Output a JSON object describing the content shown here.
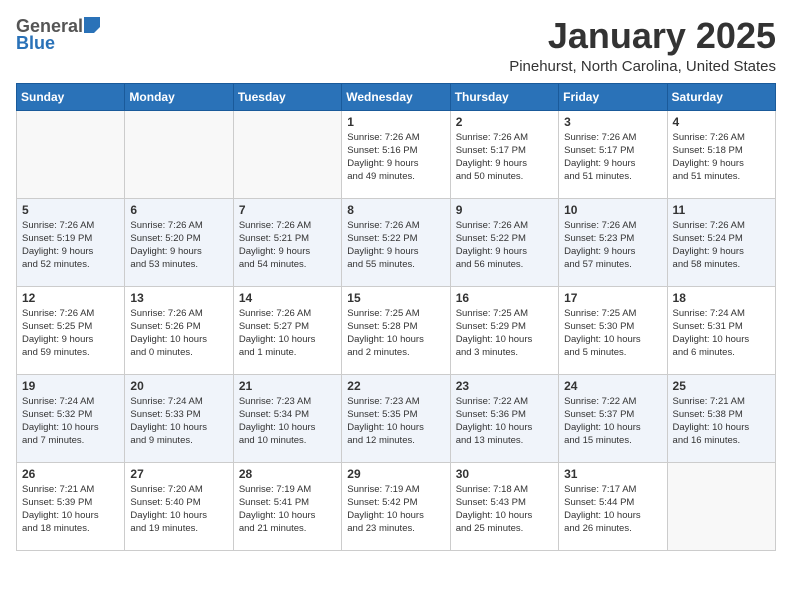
{
  "header": {
    "logo_general": "General",
    "logo_blue": "Blue",
    "month_title": "January 2025",
    "location": "Pinehurst, North Carolina, United States"
  },
  "weekdays": [
    "Sunday",
    "Monday",
    "Tuesday",
    "Wednesday",
    "Thursday",
    "Friday",
    "Saturday"
  ],
  "weeks": [
    [
      {
        "day": "",
        "info": ""
      },
      {
        "day": "",
        "info": ""
      },
      {
        "day": "",
        "info": ""
      },
      {
        "day": "1",
        "info": "Sunrise: 7:26 AM\nSunset: 5:16 PM\nDaylight: 9 hours\nand 49 minutes."
      },
      {
        "day": "2",
        "info": "Sunrise: 7:26 AM\nSunset: 5:17 PM\nDaylight: 9 hours\nand 50 minutes."
      },
      {
        "day": "3",
        "info": "Sunrise: 7:26 AM\nSunset: 5:17 PM\nDaylight: 9 hours\nand 51 minutes."
      },
      {
        "day": "4",
        "info": "Sunrise: 7:26 AM\nSunset: 5:18 PM\nDaylight: 9 hours\nand 51 minutes."
      }
    ],
    [
      {
        "day": "5",
        "info": "Sunrise: 7:26 AM\nSunset: 5:19 PM\nDaylight: 9 hours\nand 52 minutes."
      },
      {
        "day": "6",
        "info": "Sunrise: 7:26 AM\nSunset: 5:20 PM\nDaylight: 9 hours\nand 53 minutes."
      },
      {
        "day": "7",
        "info": "Sunrise: 7:26 AM\nSunset: 5:21 PM\nDaylight: 9 hours\nand 54 minutes."
      },
      {
        "day": "8",
        "info": "Sunrise: 7:26 AM\nSunset: 5:22 PM\nDaylight: 9 hours\nand 55 minutes."
      },
      {
        "day": "9",
        "info": "Sunrise: 7:26 AM\nSunset: 5:22 PM\nDaylight: 9 hours\nand 56 minutes."
      },
      {
        "day": "10",
        "info": "Sunrise: 7:26 AM\nSunset: 5:23 PM\nDaylight: 9 hours\nand 57 minutes."
      },
      {
        "day": "11",
        "info": "Sunrise: 7:26 AM\nSunset: 5:24 PM\nDaylight: 9 hours\nand 58 minutes."
      }
    ],
    [
      {
        "day": "12",
        "info": "Sunrise: 7:26 AM\nSunset: 5:25 PM\nDaylight: 9 hours\nand 59 minutes."
      },
      {
        "day": "13",
        "info": "Sunrise: 7:26 AM\nSunset: 5:26 PM\nDaylight: 10 hours\nand 0 minutes."
      },
      {
        "day": "14",
        "info": "Sunrise: 7:26 AM\nSunset: 5:27 PM\nDaylight: 10 hours\nand 1 minute."
      },
      {
        "day": "15",
        "info": "Sunrise: 7:25 AM\nSunset: 5:28 PM\nDaylight: 10 hours\nand 2 minutes."
      },
      {
        "day": "16",
        "info": "Sunrise: 7:25 AM\nSunset: 5:29 PM\nDaylight: 10 hours\nand 3 minutes."
      },
      {
        "day": "17",
        "info": "Sunrise: 7:25 AM\nSunset: 5:30 PM\nDaylight: 10 hours\nand 5 minutes."
      },
      {
        "day": "18",
        "info": "Sunrise: 7:24 AM\nSunset: 5:31 PM\nDaylight: 10 hours\nand 6 minutes."
      }
    ],
    [
      {
        "day": "19",
        "info": "Sunrise: 7:24 AM\nSunset: 5:32 PM\nDaylight: 10 hours\nand 7 minutes."
      },
      {
        "day": "20",
        "info": "Sunrise: 7:24 AM\nSunset: 5:33 PM\nDaylight: 10 hours\nand 9 minutes."
      },
      {
        "day": "21",
        "info": "Sunrise: 7:23 AM\nSunset: 5:34 PM\nDaylight: 10 hours\nand 10 minutes."
      },
      {
        "day": "22",
        "info": "Sunrise: 7:23 AM\nSunset: 5:35 PM\nDaylight: 10 hours\nand 12 minutes."
      },
      {
        "day": "23",
        "info": "Sunrise: 7:22 AM\nSunset: 5:36 PM\nDaylight: 10 hours\nand 13 minutes."
      },
      {
        "day": "24",
        "info": "Sunrise: 7:22 AM\nSunset: 5:37 PM\nDaylight: 10 hours\nand 15 minutes."
      },
      {
        "day": "25",
        "info": "Sunrise: 7:21 AM\nSunset: 5:38 PM\nDaylight: 10 hours\nand 16 minutes."
      }
    ],
    [
      {
        "day": "26",
        "info": "Sunrise: 7:21 AM\nSunset: 5:39 PM\nDaylight: 10 hours\nand 18 minutes."
      },
      {
        "day": "27",
        "info": "Sunrise: 7:20 AM\nSunset: 5:40 PM\nDaylight: 10 hours\nand 19 minutes."
      },
      {
        "day": "28",
        "info": "Sunrise: 7:19 AM\nSunset: 5:41 PM\nDaylight: 10 hours\nand 21 minutes."
      },
      {
        "day": "29",
        "info": "Sunrise: 7:19 AM\nSunset: 5:42 PM\nDaylight: 10 hours\nand 23 minutes."
      },
      {
        "day": "30",
        "info": "Sunrise: 7:18 AM\nSunset: 5:43 PM\nDaylight: 10 hours\nand 25 minutes."
      },
      {
        "day": "31",
        "info": "Sunrise: 7:17 AM\nSunset: 5:44 PM\nDaylight: 10 hours\nand 26 minutes."
      },
      {
        "day": "",
        "info": ""
      }
    ]
  ]
}
